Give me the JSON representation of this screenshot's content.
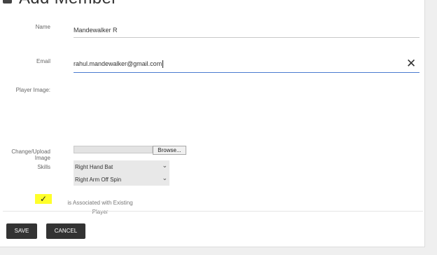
{
  "page": {
    "title": "Add Member"
  },
  "form": {
    "name": {
      "label": "Name",
      "value": "Mandewalker R"
    },
    "email": {
      "label": "Email",
      "value": "rahul.mandewalker@gmail.com",
      "clear_icon": "close-icon"
    },
    "player_image": {
      "label": "Player Image:"
    },
    "upload": {
      "label": "Change/Upload Image",
      "browse_label": "Browse..."
    },
    "skills": {
      "label": "Skills",
      "batting": "Right Hand Bat",
      "bowling": "Right Arm Off Spin"
    },
    "associated": {
      "checked": true,
      "check_glyph": "✓",
      "highlight_color": "#ffff2a",
      "label": "is Associated with Existing Player"
    }
  },
  "actions": {
    "save_label": "SAVE",
    "cancel_label": "CANCEL"
  }
}
